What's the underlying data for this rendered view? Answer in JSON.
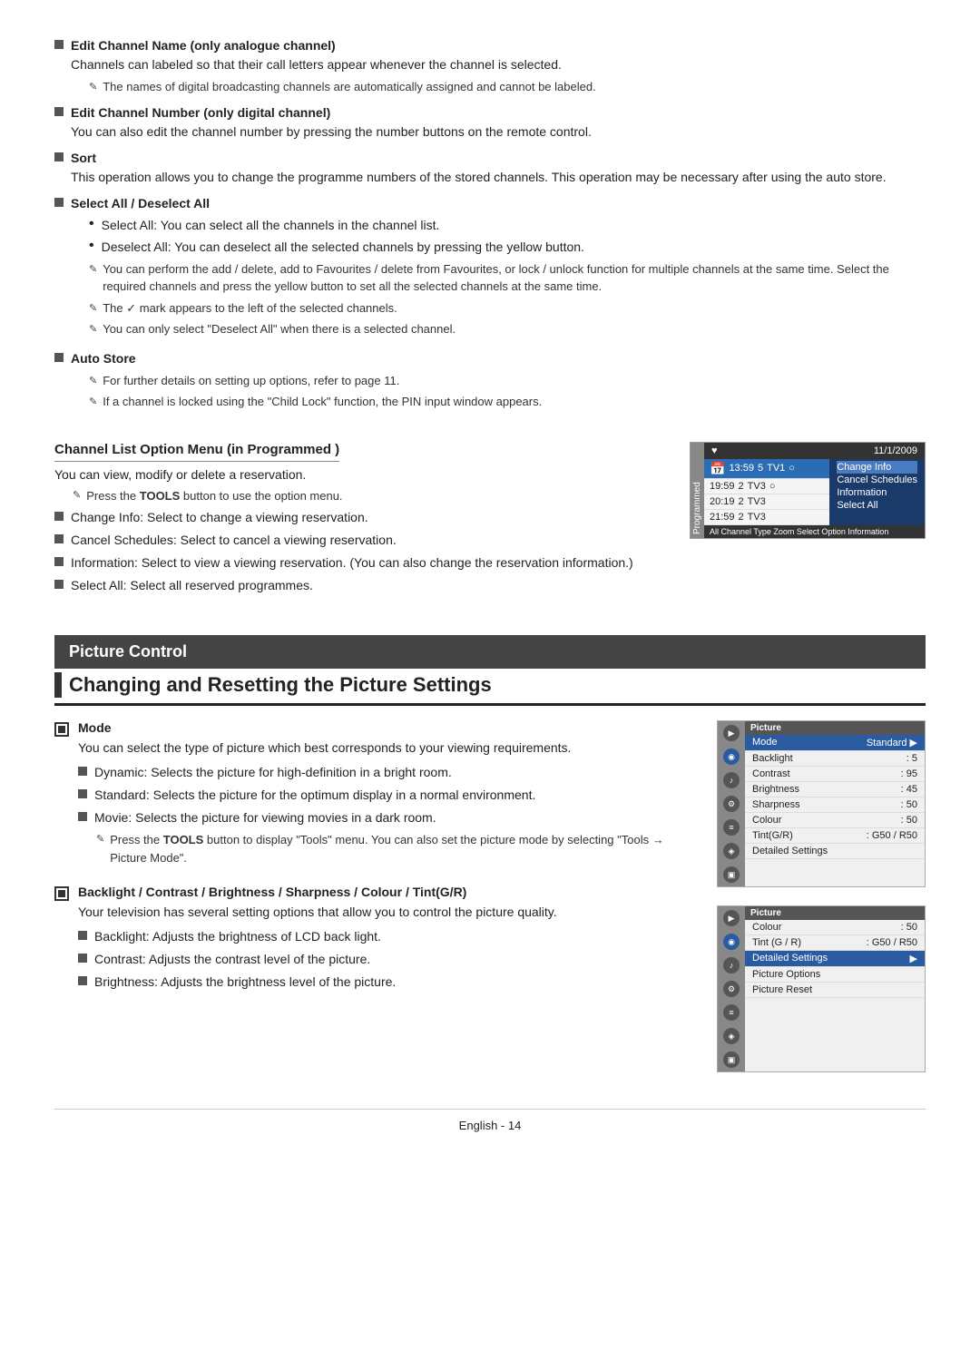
{
  "page": {
    "footer": "English - 14"
  },
  "top_section": {
    "items": [
      {
        "title": "Edit Channel Name (only analogue channel)",
        "body": "Channels can labeled so that their call letters appear whenever the channel is selected.",
        "note": "The names of digital broadcasting channels are automatically assigned and cannot be labeled."
      },
      {
        "title": "Edit Channel Number (only digital channel)",
        "body": "You can also edit the channel number by pressing the number buttons on the remote control."
      },
      {
        "title": "Sort",
        "body": "This operation allows you to change the programme numbers of the stored channels. This operation may be necessary after using the auto store."
      },
      {
        "title": "Select All / Deselect All",
        "sub_bullets": [
          "Select All: You can select all the channels in the channel list.",
          "Deselect All: You can deselect all the selected channels by pressing the yellow button."
        ],
        "notes": [
          "You can perform the add / delete, add to Favourites / delete from Favourites, or lock / unlock function for multiple channels at the same time. Select the required channels and press the yellow button to set all the selected channels at the same time.",
          "The ✓ mark appears to the left of the selected channels.",
          "You can only select \"Deselect All\" when there is a selected channel."
        ]
      },
      {
        "title": "Auto Store",
        "notes": [
          "For further details on setting up options, refer to page 11.",
          "If a channel is locked using the \"Child Lock\" function, the PIN input window appears."
        ]
      }
    ]
  },
  "channel_list_section": {
    "subtitle": "Channel List Option Menu (in Programmed )",
    "intro": "You can view, modify or delete a reservation.",
    "tools_note": "Press the TOOLS button to use the option menu.",
    "items": [
      "Change Info: Select to change a viewing reservation.",
      "Cancel Schedules: Select to cancel a viewing reservation.",
      "Information: Select to view a viewing reservation. (You can also change the reservation information.)",
      "Select All: Select all reserved programmes."
    ],
    "tv_ui": {
      "header": "Programmed",
      "date": "11/1/2009",
      "rows": [
        {
          "time": "13:59",
          "ch": "5",
          "type": "TV1",
          "menu": "Change Info"
        },
        {
          "time": "19:59",
          "ch": "2",
          "type": "TV3",
          "menu": "Cancel Schedules"
        },
        {
          "time": "20:19",
          "ch": "2",
          "type": "TV3",
          "menu": "Information"
        },
        {
          "time": "21:59",
          "ch": "2",
          "type": "TV3",
          "menu": "Select All"
        }
      ],
      "footer": "All  Channel Type  Zoom  Select  Option  Information"
    }
  },
  "picture_control": {
    "section_header": "Picture Control",
    "main_header": "Changing and Resetting the Picture Settings",
    "mode_section": {
      "title": "Mode",
      "intro": "You can select the type of picture which best corresponds to your viewing requirements.",
      "items": [
        "Dynamic: Selects the picture for high-definition in a bright room.",
        "Standard: Selects the picture for the optimum display in a normal environment.",
        "Movie: Selects the picture for viewing movies in a dark room."
      ],
      "tools_note": "Press the TOOLS button to display \"Tools\" menu. You can also set the picture mode by selecting \"Tools → Picture Mode\"."
    },
    "backlight_section": {
      "title": "Backlight / Contrast / Brightness / Sharpness / Colour / Tint(G/R)",
      "intro": "Your television has several setting options that allow you to control the picture quality.",
      "items": [
        "Backlight: Adjusts the brightness of LCD back light.",
        "Contrast: Adjusts the contrast level of the picture.",
        "Brightness: Adjusts the brightness level of the picture."
      ]
    },
    "menu1": {
      "header": "Picture",
      "rows": [
        {
          "label": "Mode",
          "value": "Standard",
          "arrow": true,
          "active": true
        },
        {
          "label": "Backlight",
          "value": "5"
        },
        {
          "label": "Contrast",
          "value": "95"
        },
        {
          "label": "Brightness",
          "value": "45"
        },
        {
          "label": "Sharpness",
          "value": "50"
        },
        {
          "label": "Colour",
          "value": "50"
        },
        {
          "label": "Tint(G/R)",
          "value": "G50 / R50"
        },
        {
          "label": "Detailed Settings",
          "value": "",
          "arrow": false
        }
      ]
    },
    "menu2": {
      "header": "Picture",
      "rows": [
        {
          "label": "Colour",
          "value": "50"
        },
        {
          "label": "Tint (G / R)",
          "value": "G50 / R50"
        },
        {
          "label": "Detailed Settings",
          "value": "",
          "active": true,
          "arrow": true
        },
        {
          "label": "Picture Options",
          "value": ""
        },
        {
          "label": "Picture Reset",
          "value": ""
        }
      ]
    }
  }
}
